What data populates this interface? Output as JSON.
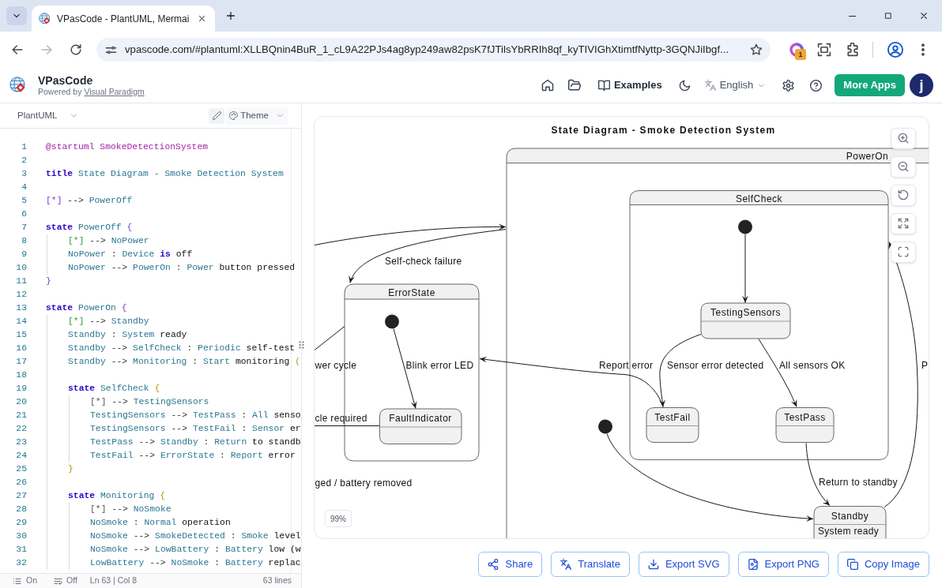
{
  "browser": {
    "tab_title": "VPasCode - PlantUML, Mermai",
    "url": "vpascode.com/#plantuml:XLLBQnin4BuR_1_cL9A22PJs4ag8yp249aw82psK7fJTilsYbRRIh8qf_kyTIVIGhXtimtfNyttp-3GQNJiIbgf...",
    "extension_badge": "1"
  },
  "header": {
    "app_name": "VPasCode",
    "powered_by": "Powered by",
    "powered_by_link": "Visual Paradigm",
    "examples": "Examples",
    "language": "English",
    "more_apps": "More Apps",
    "avatar_initial": "j"
  },
  "editor": {
    "language": "PlantUML",
    "theme": "Theme",
    "lines": [
      {
        "number": "1",
        "tokens": [
          {
            "kind": "directive",
            "text": "@startuml SmokeDetectionSystem"
          }
        ]
      },
      {
        "number": "2"
      },
      {
        "number": "3",
        "tokens": [
          {
            "kind": "keyword",
            "text": "title"
          },
          {
            "kind": "name",
            "text": " State Diagram - Smoke Detection System"
          }
        ]
      },
      {
        "number": "4"
      },
      {
        "number": "5",
        "tokens": [
          {
            "kind": "brace1",
            "text": "[*]"
          },
          {
            "kind": "op",
            "text": " --> "
          },
          {
            "kind": "name",
            "text": "PowerOff"
          }
        ]
      },
      {
        "number": "6"
      },
      {
        "number": "7",
        "tokens": [
          {
            "kind": "keyword",
            "text": "state"
          },
          {
            "kind": "name",
            "text": " PowerOff "
          },
          {
            "kind": "brace1",
            "text": "{"
          }
        ],
        "children": [
          {
            "number": "8",
            "tokens": [
              {
                "kind": "brace2",
                "text": "[*]"
              },
              {
                "kind": "op",
                "text": " --> "
              },
              {
                "kind": "name",
                "text": "NoPower"
              }
            ]
          },
          {
            "number": "9",
            "tokens": [
              {
                "kind": "name",
                "text": "NoPower"
              },
              {
                "kind": "op",
                "text": " : "
              },
              {
                "kind": "name",
                "text": "Device "
              },
              {
                "kind": "keyword",
                "text": "is"
              },
              {
                "kind": "text",
                "text": " off"
              }
            ]
          },
          {
            "number": "10",
            "tokens": [
              {
                "kind": "name",
                "text": "NoPower"
              },
              {
                "kind": "op",
                "text": " --> "
              },
              {
                "kind": "name",
                "text": "PowerOn"
              },
              {
                "kind": "op",
                "text": " : "
              },
              {
                "kind": "name",
                "text": "Power"
              },
              {
                "kind": "text",
                "text": " button pressed"
              }
            ]
          }
        ]
      },
      {
        "number": "11",
        "tokens": [
          {
            "kind": "brace1",
            "text": "}"
          }
        ]
      },
      {
        "number": "12"
      },
      {
        "number": "13",
        "tokens": [
          {
            "kind": "keyword",
            "text": "state"
          },
          {
            "kind": "name",
            "text": " PowerOn "
          },
          {
            "kind": "brace1",
            "text": "{"
          }
        ],
        "children": [
          {
            "number": "14",
            "tokens": [
              {
                "kind": "brace2",
                "text": "[*]"
              },
              {
                "kind": "op",
                "text": " --> "
              },
              {
                "kind": "name",
                "text": "Standby"
              }
            ]
          },
          {
            "number": "15",
            "tokens": [
              {
                "kind": "name",
                "text": "Standby"
              },
              {
                "kind": "op",
                "text": " : "
              },
              {
                "kind": "name",
                "text": "System"
              },
              {
                "kind": "text",
                "text": " ready"
              }
            ]
          },
          {
            "number": "16",
            "tokens": [
              {
                "kind": "name",
                "text": "Standby"
              },
              {
                "kind": "op",
                "text": " --> "
              },
              {
                "kind": "name",
                "text": "SelfCheck"
              },
              {
                "kind": "op",
                "text": " : "
              },
              {
                "kind": "name",
                "text": "Periodic"
              },
              {
                "kind": "text",
                "text": " self-test"
              }
            ]
          },
          {
            "number": "17",
            "tokens": [
              {
                "kind": "name",
                "text": "Standby"
              },
              {
                "kind": "op",
                "text": " --> "
              },
              {
                "kind": "name",
                "text": "Monitoring"
              },
              {
                "kind": "op",
                "text": " : "
              },
              {
                "kind": "name",
                "text": "Start"
              },
              {
                "kind": "text",
                "text": " monitoring "
              },
              {
                "kind": "brace3",
                "text": "("
              }
            ]
          },
          {
            "number": "18"
          },
          {
            "number": "19",
            "tokens": [
              {
                "kind": "keyword",
                "text": "state"
              },
              {
                "kind": "name",
                "text": " SelfCheck "
              },
              {
                "kind": "brace3",
                "text": "{"
              }
            ],
            "children": [
              {
                "number": "20",
                "tokens": [
                  {
                    "kind": "brace4",
                    "text": "[*]"
                  },
                  {
                    "kind": "op",
                    "text": " --> "
                  },
                  {
                    "kind": "name",
                    "text": "TestingSensors"
                  }
                ]
              },
              {
                "number": "21",
                "tokens": [
                  {
                    "kind": "name",
                    "text": "TestingSensors"
                  },
                  {
                    "kind": "op",
                    "text": " --> "
                  },
                  {
                    "kind": "name",
                    "text": "TestPass"
                  },
                  {
                    "kind": "op",
                    "text": " : "
                  },
                  {
                    "kind": "name",
                    "text": "All"
                  },
                  {
                    "kind": "text",
                    "text": " senso"
                  }
                ]
              },
              {
                "number": "22",
                "tokens": [
                  {
                    "kind": "name",
                    "text": "TestingSensors"
                  },
                  {
                    "kind": "op",
                    "text": " --> "
                  },
                  {
                    "kind": "name",
                    "text": "TestFail"
                  },
                  {
                    "kind": "op",
                    "text": " : "
                  },
                  {
                    "kind": "name",
                    "text": "Sensor"
                  },
                  {
                    "kind": "text",
                    "text": " er"
                  }
                ]
              },
              {
                "number": "23",
                "tokens": [
                  {
                    "kind": "name",
                    "text": "TestPass"
                  },
                  {
                    "kind": "op",
                    "text": " --> "
                  },
                  {
                    "kind": "name",
                    "text": "Standby"
                  },
                  {
                    "kind": "op",
                    "text": " : "
                  },
                  {
                    "kind": "name",
                    "text": "Return"
                  },
                  {
                    "kind": "text",
                    "text": " to standb"
                  }
                ]
              },
              {
                "number": "24",
                "tokens": [
                  {
                    "kind": "name",
                    "text": "TestFail"
                  },
                  {
                    "kind": "op",
                    "text": " --> "
                  },
                  {
                    "kind": "name",
                    "text": "ErrorState"
                  },
                  {
                    "kind": "op",
                    "text": " : "
                  },
                  {
                    "kind": "name",
                    "text": "Report"
                  },
                  {
                    "kind": "text",
                    "text": " error"
                  }
                ]
              }
            ]
          },
          {
            "number": "25",
            "tokens": [
              {
                "kind": "brace3",
                "text": "}"
              }
            ]
          },
          {
            "number": "26"
          },
          {
            "number": "27",
            "tokens": [
              {
                "kind": "keyword",
                "text": "state"
              },
              {
                "kind": "name",
                "text": " Monitoring "
              },
              {
                "kind": "brace3",
                "text": "{"
              }
            ],
            "children": [
              {
                "number": "28",
                "tokens": [
                  {
                    "kind": "brace4",
                    "text": "[*]"
                  },
                  {
                    "kind": "op",
                    "text": " --> "
                  },
                  {
                    "kind": "name",
                    "text": "NoSmoke"
                  }
                ]
              },
              {
                "number": "29",
                "tokens": [
                  {
                    "kind": "name",
                    "text": "NoSmoke"
                  },
                  {
                    "kind": "op",
                    "text": " : "
                  },
                  {
                    "kind": "name",
                    "text": "Normal"
                  },
                  {
                    "kind": "text",
                    "text": " operation"
                  }
                ]
              },
              {
                "number": "30",
                "tokens": [
                  {
                    "kind": "name",
                    "text": "NoSmoke"
                  },
                  {
                    "kind": "op",
                    "text": " --> "
                  },
                  {
                    "kind": "name",
                    "text": "SmokeDetected"
                  },
                  {
                    "kind": "op",
                    "text": " : "
                  },
                  {
                    "kind": "name",
                    "text": "Smoke"
                  },
                  {
                    "kind": "text",
                    "text": " level"
                  }
                ]
              },
              {
                "number": "31",
                "tokens": [
                  {
                    "kind": "name",
                    "text": "NoSmoke"
                  },
                  {
                    "kind": "op",
                    "text": " --> "
                  },
                  {
                    "kind": "name",
                    "text": "LowBattery"
                  },
                  {
                    "kind": "op",
                    "text": " : "
                  },
                  {
                    "kind": "name",
                    "text": "Battery"
                  },
                  {
                    "kind": "text",
                    "text": " low (w"
                  }
                ]
              },
              {
                "number": "32",
                "tokens": [
                  {
                    "kind": "name",
                    "text": "LowBattery"
                  },
                  {
                    "kind": "op",
                    "text": " --> "
                  },
                  {
                    "kind": "name",
                    "text": "NoSmoke"
                  },
                  {
                    "kind": "op",
                    "text": " : "
                  },
                  {
                    "kind": "name",
                    "text": "Battery"
                  },
                  {
                    "kind": "text",
                    "text": " replac"
                  }
                ]
              }
            ]
          }
        ]
      }
    ],
    "status": {
      "list_toggle": "On",
      "wrap_toggle": "Off",
      "cursor": "Ln 63 | Col 8",
      "line_count": "63 lines"
    }
  },
  "diagram": {
    "title": "State Diagram - Smoke Detection System",
    "states": [
      {
        "name": "PowerOn",
        "kind": "composite"
      },
      {
        "name": "SelfCheck",
        "kind": "composite"
      },
      {
        "name": "TestingSensors",
        "kind": "simple"
      },
      {
        "name": "TestFail",
        "kind": "simple"
      },
      {
        "name": "TestPass",
        "kind": "simple"
      },
      {
        "name": "ErrorState",
        "kind": "composite"
      },
      {
        "name": "FaultIndicator",
        "kind": "simple"
      },
      {
        "name": "Standby",
        "kind": "simple",
        "description": "System ready"
      }
    ],
    "labels": [
      "Self-check failure",
      "wer cycle",
      "Blink error LED",
      "Report error",
      "Sensor error detected",
      "All sensors OK",
      "P",
      "cle required",
      "ged / battery removed",
      "Return to standby"
    ],
    "zoom_level": "99%"
  },
  "actions": [
    {
      "label": "Share",
      "kind": "share"
    },
    {
      "label": "Translate",
      "kind": "translate"
    },
    {
      "label": "Export SVG",
      "kind": "download"
    },
    {
      "label": "Export PNG",
      "kind": "image"
    },
    {
      "label": "Copy Image",
      "kind": "copy"
    }
  ]
}
